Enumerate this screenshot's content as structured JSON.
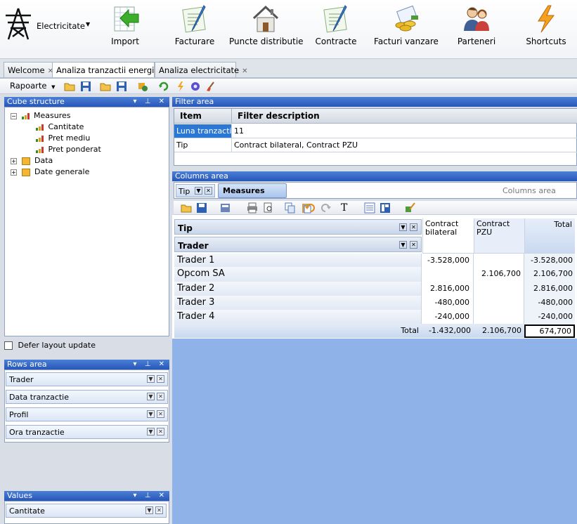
{
  "ribbon": {
    "app_label": "Electricitate",
    "buttons": [
      {
        "label": "Import",
        "icon": "import-sheet-icon"
      },
      {
        "label": "Facturare",
        "icon": "invoice-pen-icon"
      },
      {
        "label": "Puncte distributie",
        "icon": "house-icon"
      },
      {
        "label": "Contracte",
        "icon": "contract-pen-icon"
      },
      {
        "label": "Facturi vanzare",
        "icon": "coins-invoice-icon"
      },
      {
        "label": "Parteneri",
        "icon": "people-icon"
      },
      {
        "label": "Shortcuts",
        "icon": "lightning-icon"
      }
    ]
  },
  "tabs": [
    {
      "label": "Welcome",
      "active": false
    },
    {
      "label": "Analiza tranzactii energie",
      "active": true
    },
    {
      "label": "Analiza electricitate",
      "active": false
    }
  ],
  "toolbar": {
    "rapoarte_label": "Rapoarte"
  },
  "cube_structure": {
    "title": "Cube structure",
    "measures_label": "Measures",
    "measures": [
      "Cantitate",
      "Pret mediu",
      "Pret ponderat"
    ],
    "dimensions": [
      "Data",
      "Date generale"
    ]
  },
  "defer_label": "Defer layout update",
  "rows_area": {
    "title": "Rows area",
    "fields": [
      "Trader",
      "Data tranzactie",
      "Profil",
      "Ora tranzactie"
    ]
  },
  "values_area": {
    "title": "Values",
    "fields": [
      "Cantitate"
    ]
  },
  "filter_area": {
    "title": "Filter area",
    "col_item": "Item",
    "col_desc": "Filter description",
    "rows": [
      {
        "item": "Luna tranzactie",
        "desc": "11"
      },
      {
        "item": "Tip",
        "desc": "Contract bilateral, Contract PZU"
      }
    ]
  },
  "columns_area": {
    "title": "Columns area",
    "chip_tip": "Tip",
    "chip_measures": "Measures",
    "hint": "Columns area"
  },
  "pivot": {
    "col_field": "Tip",
    "row_field": "Trader",
    "columns": [
      "Contract bilateral",
      "Contract PZU",
      "Total"
    ],
    "rows": [
      {
        "name": "Trader 1",
        "bilateral": "-3.528,000",
        "pzu": "",
        "total": "-3.528,000"
      },
      {
        "name": "Opcom SA",
        "bilateral": "",
        "pzu": "2.106,700",
        "total": "2.106,700"
      },
      {
        "name": "Trader 2",
        "bilateral": "2.816,000",
        "pzu": "",
        "total": "2.816,000"
      },
      {
        "name": "Trader 3",
        "bilateral": "-480,000",
        "pzu": "",
        "total": "-480,000"
      },
      {
        "name": "Trader 4",
        "bilateral": "-240,000",
        "pzu": "",
        "total": "-240,000"
      }
    ],
    "total_label": "Total",
    "totals": {
      "bilateral": "-1.432,000",
      "pzu": "2.106,700",
      "total": "674,700"
    }
  }
}
